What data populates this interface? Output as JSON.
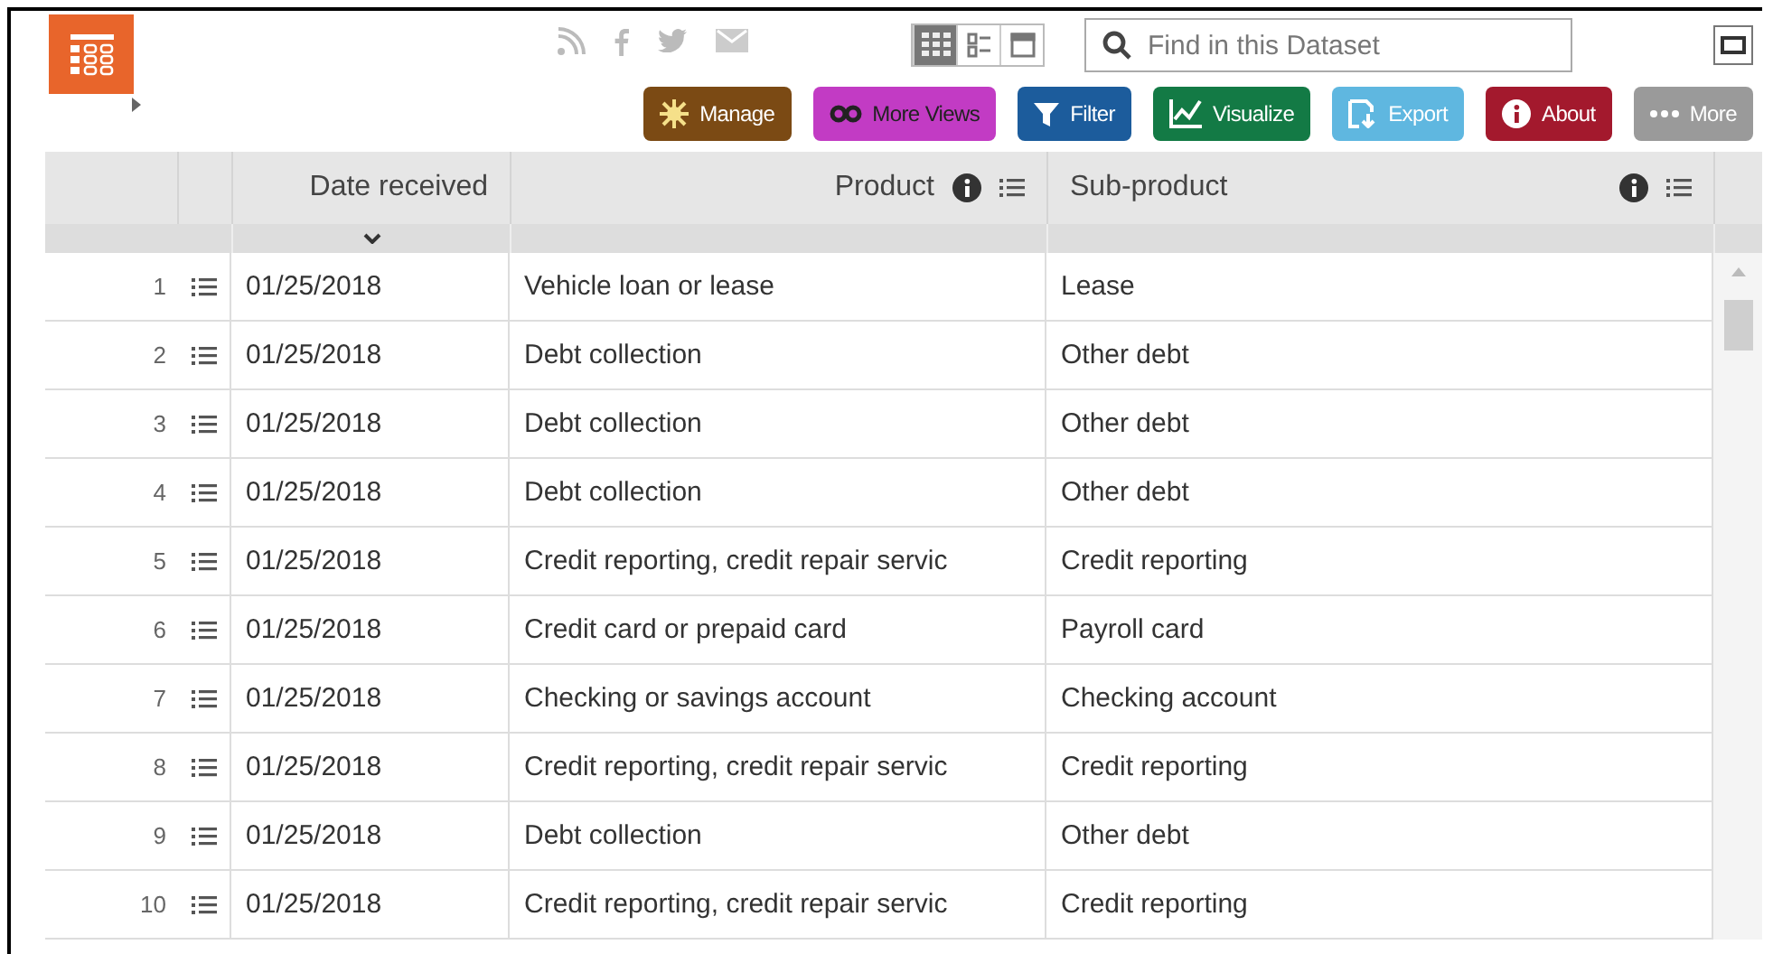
{
  "header": {
    "view_toggles": [
      {
        "kind": "table",
        "selected": true
      },
      {
        "kind": "cards",
        "selected": false
      },
      {
        "kind": "single",
        "selected": false
      }
    ],
    "search": {
      "placeholder": "Find in this Dataset"
    },
    "buttons": [
      {
        "kind": "manage",
        "label": "Manage",
        "color": "#7b4a14"
      },
      {
        "kind": "views",
        "label": "More Views",
        "color": "#c23bc4"
      },
      {
        "kind": "filter",
        "label": "Filter",
        "color": "#1c5c9c"
      },
      {
        "kind": "visualize",
        "label": "Visualize",
        "color": "#137a45"
      },
      {
        "kind": "export",
        "label": "Export",
        "color": "#5fb7e0"
      },
      {
        "kind": "about",
        "label": "About",
        "color": "#a3192d"
      },
      {
        "kind": "more",
        "label": "More",
        "color": "#9a9a9a"
      }
    ]
  },
  "table": {
    "columns": [
      {
        "label": "Date received",
        "sorted": true,
        "tools": false
      },
      {
        "label": "Product",
        "sorted": false,
        "tools": true
      },
      {
        "label": "Sub-product",
        "sorted": false,
        "tools": true
      }
    ],
    "rows": [
      {
        "number": "1",
        "cells": [
          "01/25/2018",
          "Vehicle loan or lease",
          "Lease"
        ]
      },
      {
        "number": "2",
        "cells": [
          "01/25/2018",
          "Debt collection",
          "Other debt"
        ]
      },
      {
        "number": "3",
        "cells": [
          "01/25/2018",
          "Debt collection",
          "Other debt"
        ]
      },
      {
        "number": "4",
        "cells": [
          "01/25/2018",
          "Debt collection",
          "Other debt"
        ]
      },
      {
        "number": "5",
        "cells": [
          "01/25/2018",
          "Credit reporting, credit repair servic",
          "Credit reporting"
        ]
      },
      {
        "number": "6",
        "cells": [
          "01/25/2018",
          "Credit card or prepaid card",
          "Payroll card"
        ]
      },
      {
        "number": "7",
        "cells": [
          "01/25/2018",
          "Checking or savings account",
          "Checking account"
        ]
      },
      {
        "number": "8",
        "cells": [
          "01/25/2018",
          "Credit reporting, credit repair servic",
          "Credit reporting"
        ]
      },
      {
        "number": "9",
        "cells": [
          "01/25/2018",
          "Debt collection",
          "Other debt"
        ]
      },
      {
        "number": "10",
        "cells": [
          "01/25/2018",
          "Credit reporting, credit repair servic",
          "Credit reporting"
        ]
      }
    ]
  }
}
